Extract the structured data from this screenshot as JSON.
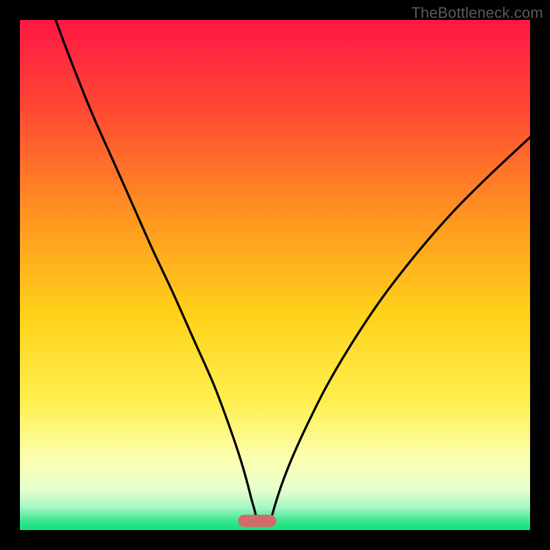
{
  "watermark": "TheBottleneck.com",
  "chart_data": {
    "type": "line",
    "title": "",
    "xlabel": "",
    "ylabel": "",
    "xlim": [
      0,
      100
    ],
    "ylim": [
      0,
      100
    ],
    "grid": false,
    "legend": false,
    "background_gradient": {
      "stops": [
        {
          "offset": 0.0,
          "color": "#ff1744"
        },
        {
          "offset": 0.18,
          "color": "#ff4a33"
        },
        {
          "offset": 0.4,
          "color": "#ff9a1f"
        },
        {
          "offset": 0.58,
          "color": "#ffd21a"
        },
        {
          "offset": 0.75,
          "color": "#fff050"
        },
        {
          "offset": 0.86,
          "color": "#fbffb0"
        },
        {
          "offset": 0.92,
          "color": "#e8ffcf"
        },
        {
          "offset": 0.955,
          "color": "#a8f7c6"
        },
        {
          "offset": 0.985,
          "color": "#2fe68a"
        },
        {
          "offset": 1.0,
          "color": "#14e07a"
        }
      ]
    },
    "marker": {
      "x": 46.5,
      "y": 1.8,
      "width": 7.5,
      "height": 2.4,
      "rx": 1.2,
      "color": "#d56a6a"
    },
    "series": [
      {
        "name": "left-curve",
        "x": [
          7.0,
          10.0,
          14.0,
          18.0,
          22.0,
          26.0,
          30.0,
          34.0,
          38.0,
          41.0,
          43.2,
          44.5,
          45.4,
          46.1,
          46.5
        ],
        "values": [
          100.0,
          92.0,
          82.0,
          73.0,
          64.0,
          55.0,
          46.5,
          37.5,
          28.5,
          20.5,
          14.0,
          9.5,
          6.0,
          3.5,
          1.3
        ]
      },
      {
        "name": "right-curve",
        "x": [
          49.0,
          49.6,
          50.5,
          51.7,
          53.5,
          56.0,
          60.0,
          65.0,
          71.0,
          78.0,
          85.0,
          92.0,
          100.0
        ],
        "values": [
          1.3,
          3.5,
          6.5,
          10.0,
          14.5,
          20.0,
          28.0,
          36.5,
          45.5,
          54.5,
          62.5,
          69.5,
          77.0
        ]
      }
    ]
  }
}
